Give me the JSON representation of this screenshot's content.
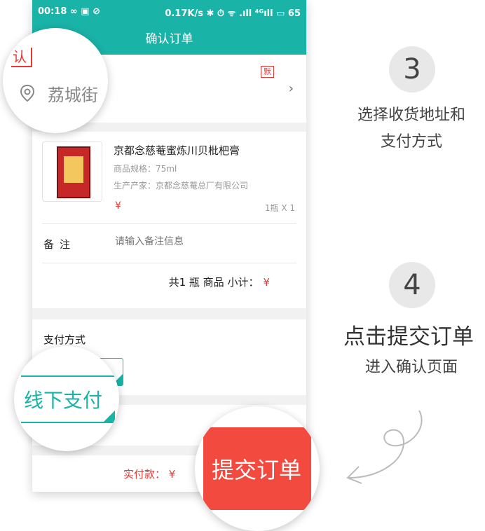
{
  "status_bar": {
    "time": "00:18 ∞ ▣ ⊘",
    "indicators": "0.17K/s ✱ ⏱ ᯤ .ıll ⁴ᴳıll ▭ 65"
  },
  "header": {
    "title": "确认订单"
  },
  "address": {
    "tag": "默",
    "chevron_icon": "chevron-right-icon"
  },
  "product": {
    "name": "京都念慈菴蜜炼川贝枇杷膏",
    "spec": "商品规格：75ml",
    "maker": "生产产家：京都念慈菴总厂有限公司",
    "price_symbol": "¥",
    "quantity": "1瓶 X 1"
  },
  "note": {
    "label": "备注",
    "placeholder": "请输入备注信息"
  },
  "summary": {
    "text": "共1 瓶 商品   小计：",
    "currency": "¥"
  },
  "payment": {
    "title": "支付方式"
  },
  "bottom_bar": {
    "amount_label": "实付款：  ¥"
  },
  "zoom_address": {
    "confirm_char": "认",
    "street": "荔城街",
    "icon": "location-pin-icon"
  },
  "zoom_payment": {
    "label": "线下支付"
  },
  "zoom_submit": {
    "label": "提交订单"
  },
  "step3": {
    "number": "3",
    "line1": "选择收货地址和",
    "line2": "支付方式"
  },
  "step4": {
    "number": "4",
    "title": "点击提交订单",
    "subtitle": "进入确认页面"
  },
  "colors": {
    "accent": "#1ab3a7",
    "price_red": "#e53935",
    "submit_red": "#f24a3f"
  }
}
